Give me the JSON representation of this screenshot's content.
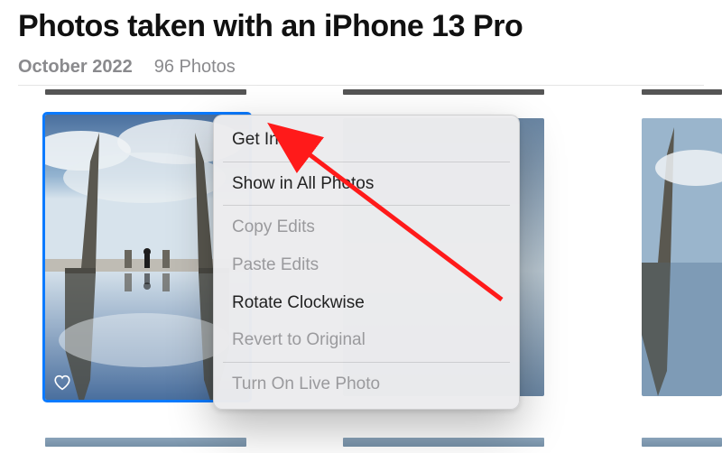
{
  "header": {
    "title": "Photos taken with an iPhone 13 Pro",
    "date": "October 2022",
    "count": "96 Photos"
  },
  "menu": {
    "get_info": "Get Info",
    "show_all": "Show in All Photos",
    "copy_edits": "Copy Edits",
    "paste_edits": "Paste Edits",
    "rotate": "Rotate Clockwise",
    "revert": "Revert to Original",
    "live_photo": "Turn On Live Photo"
  },
  "selection": {
    "favorited_icon": "heart-icon"
  },
  "annotation": {
    "arrow_color": "#ff1a1a"
  }
}
